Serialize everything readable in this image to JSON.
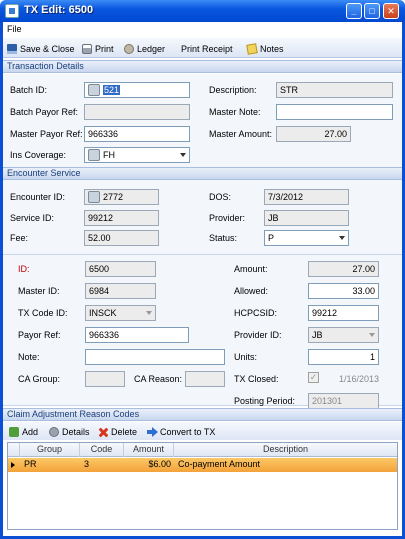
{
  "window": {
    "title": "TX Edit: 6500"
  },
  "menu": {
    "file": "File"
  },
  "toolbar": {
    "save_close": "Save & Close",
    "print": "Print",
    "ledger": "Ledger",
    "print_receipt": "Print Receipt",
    "notes": "Notes"
  },
  "transaction_details": {
    "header": "Transaction Details",
    "batch_id_label": "Batch ID:",
    "batch_id_value": "521",
    "batch_payor_ref_label": "Batch Payor Ref:",
    "batch_payor_ref_value": "",
    "master_payor_ref_label": "Master Payor Ref:",
    "master_payor_ref_value": "966336",
    "ins_coverage_label": "Ins Coverage:",
    "ins_coverage_value": "FH",
    "description_label": "Description:",
    "description_value": "STR",
    "master_note_label": "Master Note:",
    "master_note_value": "",
    "master_amount_label": "Master Amount:",
    "master_amount_value": "27.00"
  },
  "encounter_service": {
    "header": "Encounter Service",
    "encounter_id_label": "Encounter ID:",
    "encounter_id_value": "2772",
    "service_id_label": "Service ID:",
    "service_id_value": "99212",
    "fee_label": "Fee:",
    "fee_value": "52.00",
    "dos_label": "DOS:",
    "dos_value": "7/3/2012",
    "provider_label": "Provider:",
    "provider_value": "JB",
    "status_label": "Status:",
    "status_value": "P"
  },
  "tx": {
    "id_label": "ID:",
    "id_value": "6500",
    "master_id_label": "Master ID:",
    "master_id_value": "6984",
    "tx_code_id_label": "TX Code ID:",
    "tx_code_id_value": "INSCK",
    "payor_ref_label": "Payor Ref:",
    "payor_ref_value": "966336",
    "note_label": "Note:",
    "note_value": "",
    "ca_group_label": "CA Group:",
    "ca_group_value": "",
    "ca_reason_label": "CA Reason:",
    "ca_reason_value": "",
    "amount_label": "Amount:",
    "amount_value": "27.00",
    "allowed_label": "Allowed:",
    "allowed_value": "33.00",
    "hcpcsid_label": "HCPCSID:",
    "hcpcsid_value": "99212",
    "provider_id_label": "Provider ID:",
    "provider_id_value": "JB",
    "units_label": "Units:",
    "units_value": "1",
    "tx_closed_label": "TX Closed:",
    "tx_closed_date": "1/16/2013",
    "posting_period_label": "Posting Period:",
    "posting_period_value": "201301"
  },
  "carc": {
    "header": "Claim Adjustment Reason Codes",
    "add": "Add",
    "details": "Details",
    "delete": "Delete",
    "convert": "Convert to TX",
    "columns": [
      "Group",
      "Code",
      "Amount",
      "Description"
    ],
    "rows": [
      {
        "group": "PR",
        "code": "3",
        "amount": "$6.00",
        "description": "Co-payment Amount"
      }
    ]
  },
  "colors": {
    "title_bar": "#0a57e0",
    "selected_row": "#f3a23a",
    "required_label": "#c00000"
  }
}
